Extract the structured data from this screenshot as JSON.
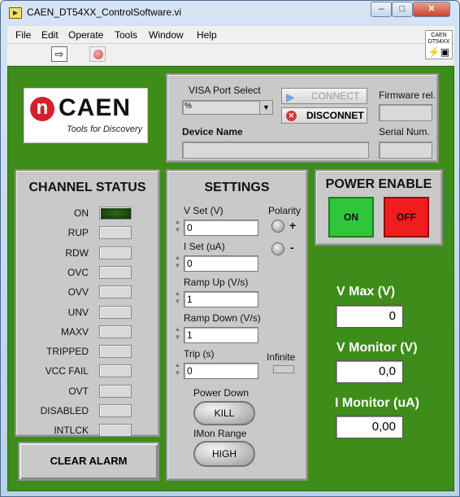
{
  "window": {
    "title": "CAEN_DT54XX_ControlSoftware.vi",
    "minimize": "–",
    "maximize": "□",
    "close": "✕"
  },
  "menu": [
    "File",
    "Edit",
    "Operate",
    "Tools",
    "Window",
    "Help"
  ],
  "vi_icon_text": "CAEN\nDT54XX",
  "logo": {
    "brand": "CAEN",
    "tagline": "Tools for Discovery"
  },
  "connection": {
    "visa_label": "VISA Port Select",
    "visa_value": "",
    "visa_prefix": "%",
    "connect_label": "CONNECT",
    "disconnect_label": "DISCONNET",
    "firmware_label": "Firmware rel.",
    "firmware_value": "",
    "device_name_label": "Device Name",
    "device_name_value": "",
    "serial_label": "Serial Num.",
    "serial_value": ""
  },
  "channel_status": {
    "title": "CHANNEL STATUS",
    "items": [
      {
        "label": "ON",
        "active": true
      },
      {
        "label": "RUP",
        "active": false
      },
      {
        "label": "RDW",
        "active": false
      },
      {
        "label": "OVC",
        "active": false
      },
      {
        "label": "OVV",
        "active": false
      },
      {
        "label": "UNV",
        "active": false
      },
      {
        "label": "MAXV",
        "active": false
      },
      {
        "label": "TRIPPED",
        "active": false
      },
      {
        "label": "VCC FAIL",
        "active": false
      },
      {
        "label": "OVT",
        "active": false
      },
      {
        "label": "DISABLED",
        "active": false
      },
      {
        "label": "INTLCK",
        "active": false
      }
    ],
    "clear_alarm": "CLEAR ALARM"
  },
  "settings": {
    "title": "SETTINGS",
    "v_set_label": "V Set (V)",
    "v_set_value": "0",
    "i_set_label": "I Set (uA)",
    "i_set_value": "0",
    "ramp_up_label": "Ramp Up (V/s)",
    "ramp_up_value": "1",
    "ramp_down_label": "Ramp Down (V/s)",
    "ramp_down_value": "1",
    "trip_label": "Trip (s)",
    "trip_value": "0",
    "polarity_label": "Polarity",
    "polarity_plus": "+",
    "polarity_minus": "-",
    "infinite_label": "Infinite",
    "power_down_label": "Power Down",
    "power_down_value": "KILL",
    "imon_range_label": "IMon Range",
    "imon_range_value": "HIGH"
  },
  "power_enable": {
    "title": "POWER ENABLE",
    "on_label": "ON",
    "off_label": "OFF"
  },
  "readouts": {
    "v_max_label": "V Max (V)",
    "v_max_value": "0",
    "v_monitor_label": "V Monitor (V)",
    "v_monitor_value": "0,0",
    "i_monitor_label": "I Monitor (uA)",
    "i_monitor_value": "0,00"
  },
  "colors": {
    "panel_green": "#3e8c1a",
    "on_green": "#2fc63a",
    "off_red": "#ee1e1e",
    "brand_red": "#d71e2b"
  }
}
